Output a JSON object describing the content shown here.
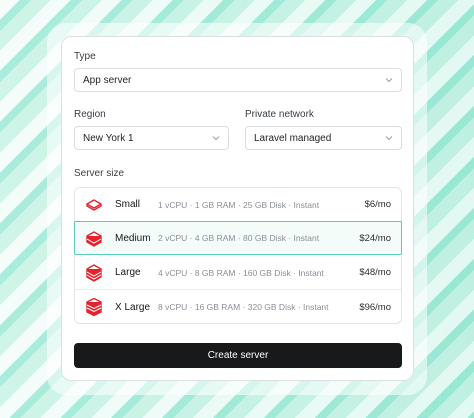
{
  "form": {
    "type_label": "Type",
    "type_value": "App server",
    "region_label": "Region",
    "region_value": "New York 1",
    "network_label": "Private network",
    "network_value": "Laravel managed",
    "size_label": "Server size",
    "create_label": "Create server"
  },
  "sizes": [
    {
      "name": "Small",
      "spec": "1 vCPU · 1 GB RAM · 25 GB Disk · Instant",
      "price": "$6/mo"
    },
    {
      "name": "Medium",
      "spec": "2 vCPU · 4 GB RAM · 80 GB Disk · Instant",
      "price": "$24/mo",
      "selected": true
    },
    {
      "name": "Large",
      "spec": "4 vCPU · 8 GB RAM · 160 GB Disk · Instant",
      "price": "$48/mo"
    },
    {
      "name": "X Large",
      "spec": "8 vCPU · 16 GB RAM · 320 GB Disk · Instant",
      "price": "$96/mo"
    }
  ],
  "colors": {
    "brand_red": "#e5232f",
    "selected_border": "#58cfb2",
    "button_bg": "#18191b"
  },
  "icons": [
    "chevron-down-icon",
    "server-stack-icon"
  ]
}
